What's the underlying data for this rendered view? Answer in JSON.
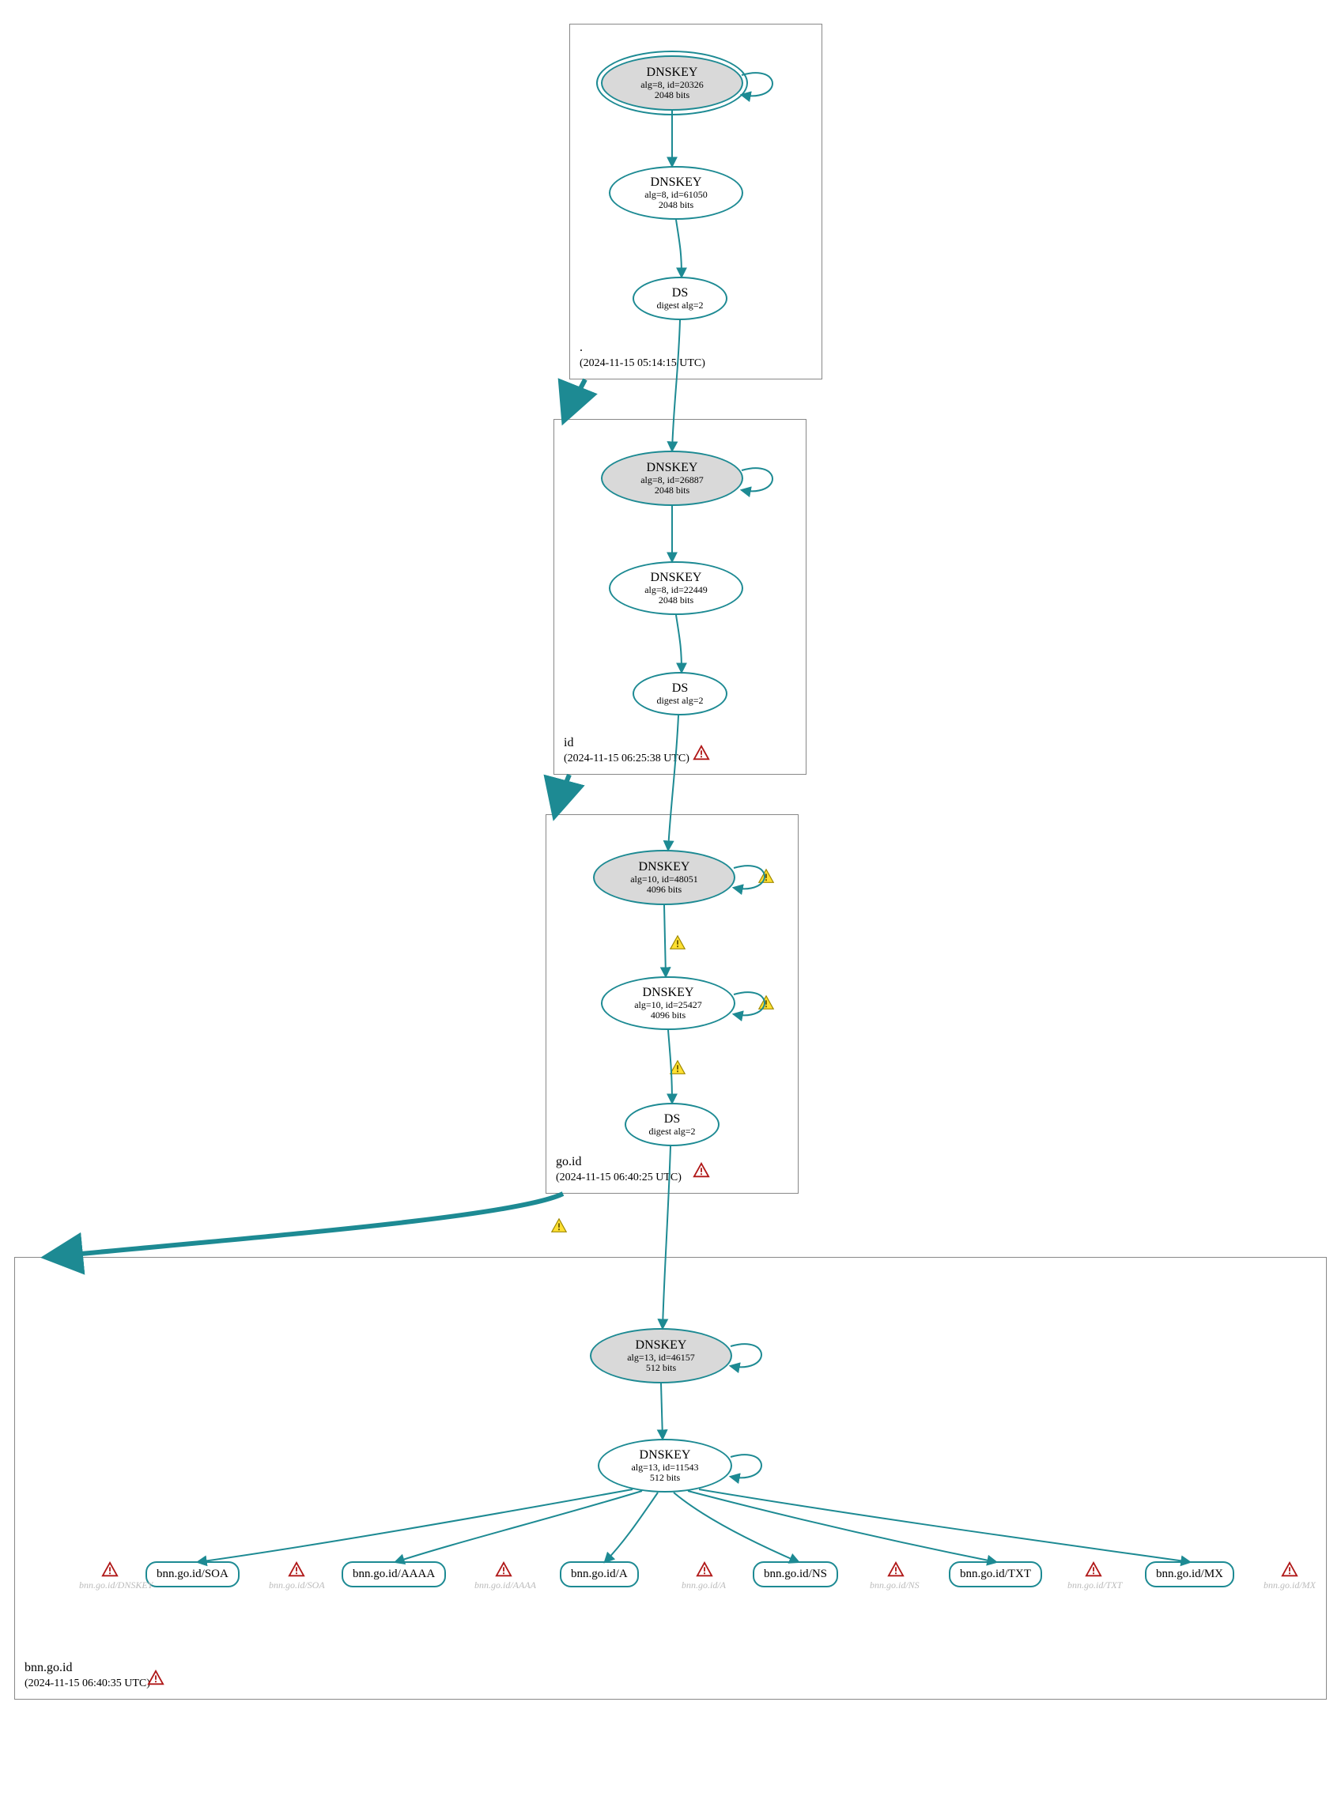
{
  "zones": {
    "root": {
      "name": ".",
      "timestamp": "(2024-11-15 05:14:15 UTC)"
    },
    "id": {
      "name": "id",
      "timestamp": "(2024-11-15 06:25:38 UTC)"
    },
    "goid": {
      "name": "go.id",
      "timestamp": "(2024-11-15 06:40:25 UTC)"
    },
    "bnn": {
      "name": "bnn.go.id",
      "timestamp": "(2024-11-15 06:40:35 UTC)"
    }
  },
  "nodes": {
    "root_ksk": {
      "title": "DNSKEY",
      "sub1": "alg=8, id=20326",
      "sub2": "2048 bits"
    },
    "root_zsk": {
      "title": "DNSKEY",
      "sub1": "alg=8, id=61050",
      "sub2": "2048 bits"
    },
    "root_ds": {
      "title": "DS",
      "sub1": "digest alg=2"
    },
    "id_ksk": {
      "title": "DNSKEY",
      "sub1": "alg=8, id=26887",
      "sub2": "2048 bits"
    },
    "id_zsk": {
      "title": "DNSKEY",
      "sub1": "alg=8, id=22449",
      "sub2": "2048 bits"
    },
    "id_ds": {
      "title": "DS",
      "sub1": "digest alg=2"
    },
    "go_ksk": {
      "title": "DNSKEY",
      "sub1": "alg=10, id=48051",
      "sub2": "4096 bits"
    },
    "go_zsk": {
      "title": "DNSKEY",
      "sub1": "alg=10, id=25427",
      "sub2": "4096 bits"
    },
    "go_ds": {
      "title": "DS",
      "sub1": "digest alg=2"
    },
    "bnn_ksk": {
      "title": "DNSKEY",
      "sub1": "alg=13, id=46157",
      "sub2": "512 bits"
    },
    "bnn_zsk": {
      "title": "DNSKEY",
      "sub1": "alg=13, id=11543",
      "sub2": "512 bits"
    }
  },
  "rrsets": {
    "soa": "bnn.go.id/SOA",
    "aaaa": "bnn.go.id/AAAA",
    "a": "bnn.go.id/A",
    "ns": "bnn.go.id/NS",
    "txt": "bnn.go.id/TXT",
    "mx": "bnn.go.id/MX"
  },
  "ghost_labels": {
    "dnskey": "bnn.go.id/DNSKEY",
    "soa": "bnn.go.id/SOA",
    "aaaa": "bnn.go.id/AAAA",
    "a": "bnn.go.id/A",
    "ns": "bnn.go.id/NS",
    "txt": "bnn.go.id/TXT",
    "mx": "bnn.go.id/MX"
  },
  "colors": {
    "stroke": "#1d8a93",
    "warn_fill": "#ffe032",
    "warn_stroke": "#6b5a00",
    "error_fill": "#ffffff",
    "error_stroke": "#b01818"
  }
}
